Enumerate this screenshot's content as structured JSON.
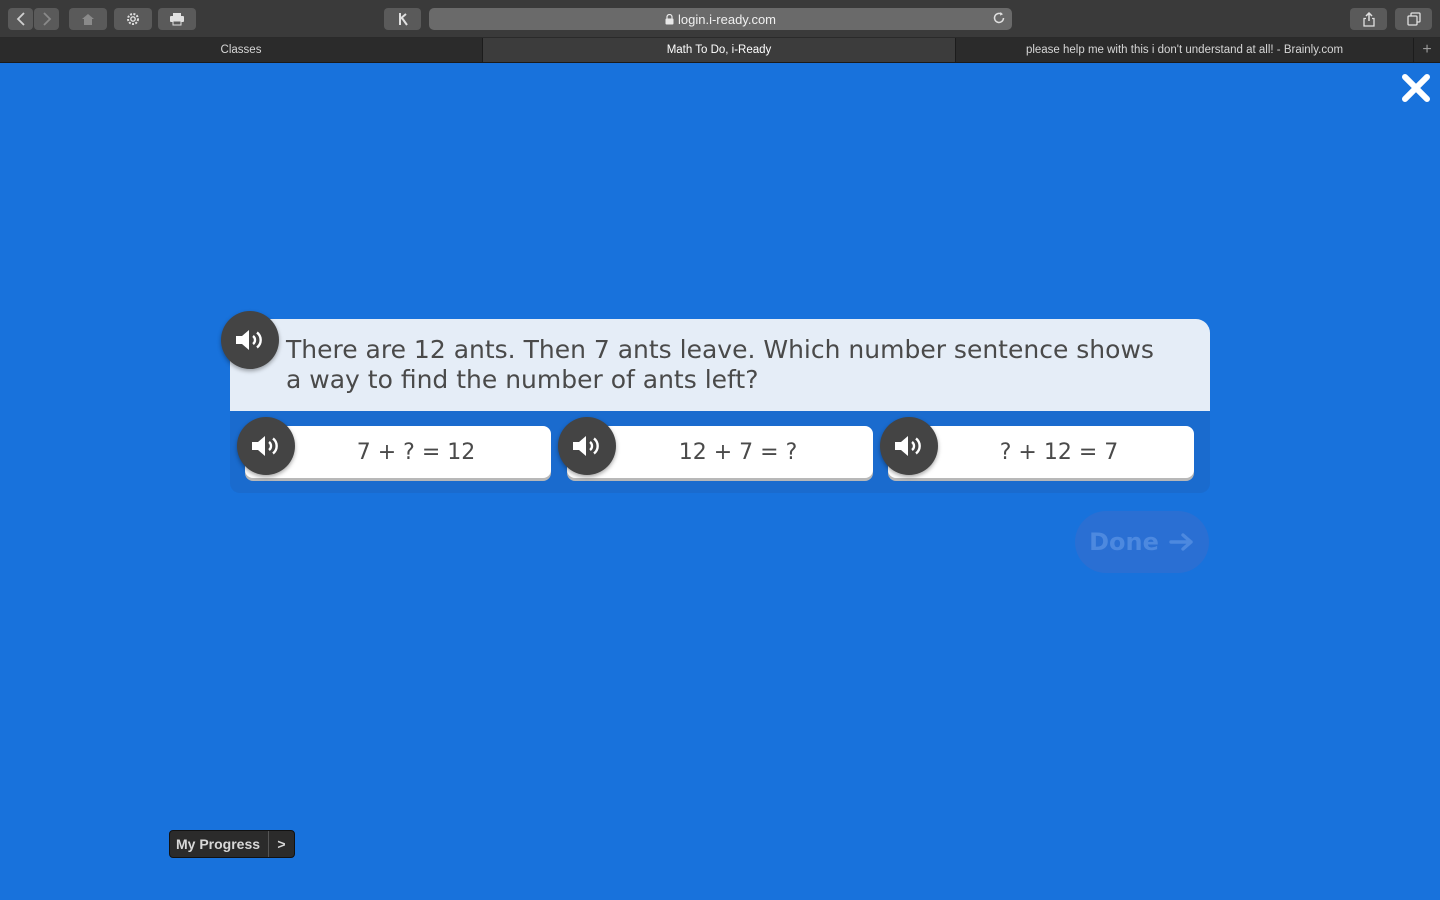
{
  "browser": {
    "url": "login.i-ready.com",
    "tabs": [
      {
        "label": "Classes",
        "active": false
      },
      {
        "label": "Math To Do, i-Ready",
        "active": true
      },
      {
        "label": "please help me with this i don't understand at all! - Brainly.com",
        "active": false
      }
    ],
    "new_tab": "+"
  },
  "lesson": {
    "question": "There are 12 ants. Then 7 ants leave. Which number sentence shows a way to find the number of ants left?",
    "choices": [
      "7 + ? = 12",
      "12 + 7 = ?",
      "? + 12 = 7"
    ],
    "done_label": "Done",
    "done_enabled": false
  },
  "footer": {
    "progress_label": "My Progress",
    "progress_chevron": ">"
  },
  "colors": {
    "background": "#1872dc",
    "question_panel": "#e5edf7",
    "speaker": "#444444",
    "text": "#4a4a4a"
  },
  "icons": [
    "back-icon",
    "forward-icon",
    "home-icon",
    "gear-icon",
    "print-icon",
    "extension-icon",
    "lock-icon",
    "reload-icon",
    "share-icon",
    "tabs-overview-icon",
    "close-icon",
    "speaker-icon",
    "arrow-right-icon"
  ]
}
